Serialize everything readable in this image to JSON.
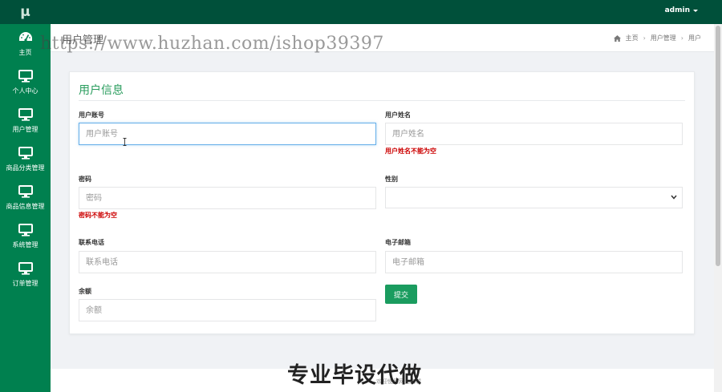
{
  "topbar": {
    "logo": "μ",
    "user": "admin"
  },
  "sidebar": {
    "items": [
      {
        "label": "主页",
        "icon": "dashboard-icon"
      },
      {
        "label": "个人中心",
        "icon": "monitor-icon"
      },
      {
        "label": "用户管理",
        "icon": "monitor-icon"
      },
      {
        "label": "商品分类管理",
        "icon": "monitor-icon"
      },
      {
        "label": "商品信息管理",
        "icon": "monitor-icon"
      },
      {
        "label": "系统管理",
        "icon": "monitor-icon"
      },
      {
        "label": "订单管理",
        "icon": "monitor-icon"
      }
    ]
  },
  "header": {
    "title": "用户管理",
    "watermark": "https://www.huzhan.com/ishop39397",
    "breadcrumb": [
      "主页",
      "用户管理",
      "用户"
    ]
  },
  "form": {
    "title": "用户信息",
    "account": {
      "label": "用户账号",
      "placeholder": "用户账号"
    },
    "name": {
      "label": "用户姓名",
      "placeholder": "用户姓名",
      "error": "用户姓名不能为空"
    },
    "password": {
      "label": "密码",
      "placeholder": "密码",
      "error": "密码不能为空"
    },
    "gender": {
      "label": "性别",
      "value": ""
    },
    "phone": {
      "label": "联系电话",
      "placeholder": "联系电话"
    },
    "email": {
      "label": "电子邮箱",
      "placeholder": "电子邮箱"
    },
    "balance": {
      "label": "余额",
      "placeholder": "余额"
    },
    "submit": "提交"
  },
  "footer": {
    "text": "欢迎使用网上商城",
    "overlay": "专业毕设代做"
  },
  "colors": {
    "topbar": "#00503a",
    "sidebar": "#00804f",
    "accent": "#1a9c5f",
    "error": "#cc0000"
  }
}
